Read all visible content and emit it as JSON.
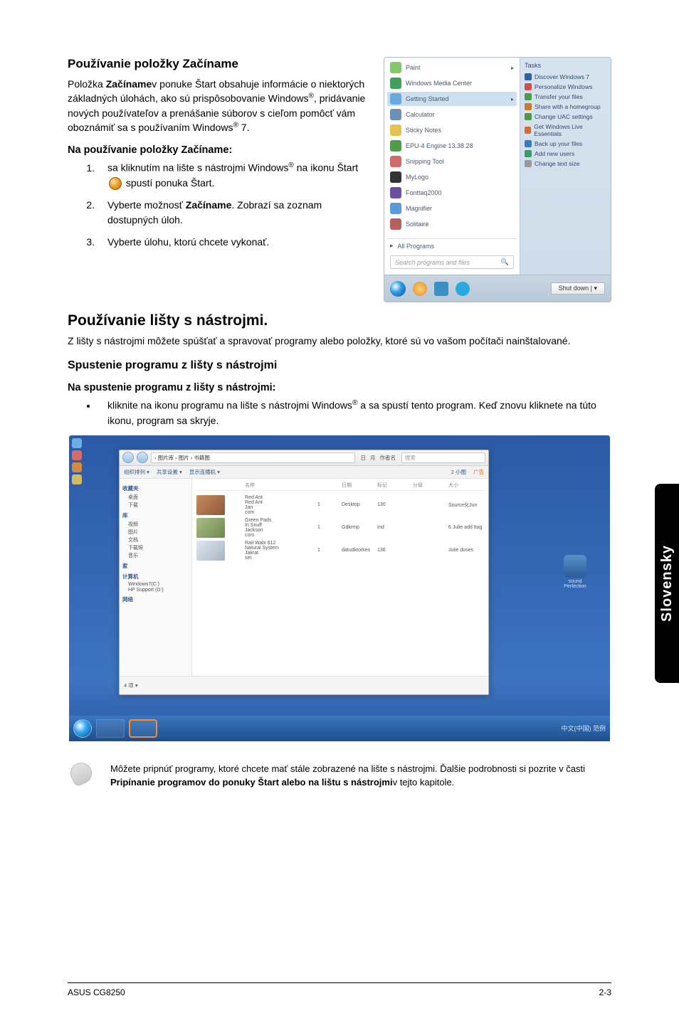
{
  "section1": {
    "title": "Používanie položky Začíname",
    "para_a": "Položka ",
    "bold_zaciname": "Začíname",
    "para_b": "v ponuke Štart obsahuje informácie o niektorých základných úlohách, ako sú prispôsobovanie  Windows",
    "para_c": ", pridávanie nových používateľov a prenášanie súborov s cieľom pomôcť vám oboznámiť sa s používaním Windows",
    "para_d": " 7.",
    "subtitle": "Na používanie položky Začíname:",
    "step1_a": "sa kliknutím na lište s nástrojmi Windows",
    "step1_b": " na ikonu Štart ",
    "step1_c": " spustí ponuka Štart.",
    "step2_a": "Vyberte možnosť ",
    "step2_bold": "Začíname",
    "step2_b": ". Zobrazí sa zoznam dostupných úloh.",
    "step3": "Vyberte úlohu, ktorú chcete vykonať."
  },
  "startmenu": {
    "items": [
      {
        "label": "Paint",
        "color": "#86c66c"
      },
      {
        "label": "Windows Media Center",
        "color": "#40a05a"
      },
      {
        "label": "Getting Started",
        "color": "#6aa8e0",
        "highlight": true,
        "arrow": "▸"
      },
      {
        "label": "Calculator",
        "color": "#6b90b5"
      },
      {
        "label": "Sticky Notes",
        "color": "#e6c14f"
      },
      {
        "label": "EPU-4 Engine 13.38.28",
        "color": "#4e9c47"
      },
      {
        "label": "Snipping Tool",
        "color": "#d06b6b"
      },
      {
        "label": "MyLogo",
        "color": "#333333"
      },
      {
        "label": "Fonttaq2000",
        "color": "#6c4fa1"
      },
      {
        "label": "Magnifier",
        "color": "#5a9ad6"
      },
      {
        "label": "Solitaire",
        "color": "#b5615e"
      }
    ],
    "all_programs": "All Programs",
    "search_placeholder": "Search programs and files",
    "shutdown": "Shut down  | ▾",
    "tasks_title": "Tasks",
    "tasks": [
      {
        "label": "Discover Windows 7",
        "color": "#2c61a5"
      },
      {
        "label": "Personalize Windows",
        "color": "#cf4e4e"
      },
      {
        "label": "Transfer your files",
        "color": "#4b9b4b"
      },
      {
        "label": "Share with a homegroup",
        "color": "#c97b2b"
      },
      {
        "label": "Change UAC settings",
        "color": "#4a9a4a"
      },
      {
        "label": "Get Windows Live Essentials",
        "color": "#d96a2e"
      },
      {
        "label": "Back up your files",
        "color": "#3a7abf"
      },
      {
        "label": "Add new users",
        "color": "#3a9a6a"
      },
      {
        "label": "Change text size",
        "color": "#999999"
      }
    ]
  },
  "section2": {
    "title": "Používanie lišty s nástrojmi.",
    "para": "Z lišty s nástrojmi môžete spúšťať a spravovať programy alebo položky, ktoré sú vo vašom počítači nainštalované."
  },
  "section3": {
    "title": "Spustenie programu z lišty s nástrojmi",
    "subtitle": "Na spustenie programu z lišty s nástrojmi:",
    "bullet_a": "kliknite na ikonu programu na lište s nástrojmi Windows",
    "bullet_b": " a sa spustí tento program. Keď znovu kliknete na túto ikonu, program sa skryje."
  },
  "explorer": {
    "location": "› 图片库 › 图片 › 书籍图",
    "search_placeholder": "搜索",
    "cols_right": [
      "日",
      "月",
      "作者名"
    ],
    "btn_back": "←",
    "btn_fwd": "→",
    "toolbar": [
      "组织排列 ▾",
      "共享设置 ▾",
      "显示连播机 ▾"
    ],
    "search_count": "2 小图",
    "extra_right": "广告",
    "cols": [
      "",
      "名称",
      "",
      "日期",
      "标记",
      "分级",
      "大小"
    ],
    "rows": [
      {
        "thumb": "brown",
        "names": [
          "Red Ant",
          "Red Ant",
          "Jan",
          "com"
        ],
        "vals": [
          "1",
          "Desktop",
          "130",
          "",
          "",
          "Source化Jun"
        ]
      },
      {
        "thumb": "green",
        "names": [
          "Green Pads",
          "In Snuff",
          "Jackson",
          "com"
        ],
        "vals": [
          "1",
          "Gdkrmp",
          "Ind",
          "",
          "",
          "6 Julie add ttag"
        ]
      },
      {
        "thumb": "winter",
        "names": [
          "Rail Wabi 612",
          "Natural System",
          "Jakrat",
          "set"
        ],
        "vals": [
          "1",
          "datudktorkes",
          "136",
          "",
          "",
          "Julie doses"
        ]
      }
    ],
    "side": {
      "grp1": "收藏夹",
      "items1": [
        "桌面",
        "下载"
      ],
      "grp2": "库",
      "items2": [
        "视频",
        "图片",
        "文档",
        "下载照",
        "音乐"
      ],
      "grp3": "家",
      "grp4": "计算机",
      "items4": [
        "Windows7(C:)",
        "HP Support (D:)"
      ],
      "grp5": "网络"
    },
    "footer": "4 项  ▾",
    "tray": "中文(中国)  范例"
  },
  "right_gadget_label": "sound Perfection",
  "note": {
    "a": "Môžete pripnúť programy, ktoré chcete mať stále zobrazené na lište s nástrojmi. Ďalšie podrobnosti si pozrite v časti ",
    "bold": "Pripínanie programov do ponuky Štart alebo na lištu s nástrojmi",
    "b": "v tejto kapitole."
  },
  "side_label": "Slovensky",
  "footer_left": "ASUS CG8250",
  "footer_right": "2-3",
  "reg_mark": "®"
}
